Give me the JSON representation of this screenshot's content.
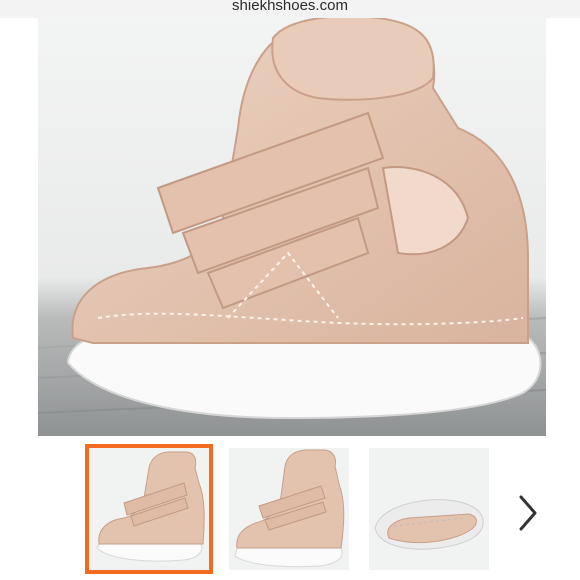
{
  "browser": {
    "url": "shiekhshoes.com"
  },
  "product": {
    "main_image": {
      "icon": "wedge-sneaker-photo",
      "color": "#e5c6b2"
    },
    "thumbnails": [
      {
        "icon": "sneaker-side-view-photo",
        "selected": true
      },
      {
        "icon": "sneaker-angle-view-photo",
        "selected": false
      },
      {
        "icon": "sneaker-sole-view-photo",
        "selected": false
      }
    ],
    "next_icon": "chevron-right-icon"
  },
  "colors": {
    "accent": "#f36b1f",
    "shoe": "#e5c6b2",
    "sole": "#ffffff"
  }
}
